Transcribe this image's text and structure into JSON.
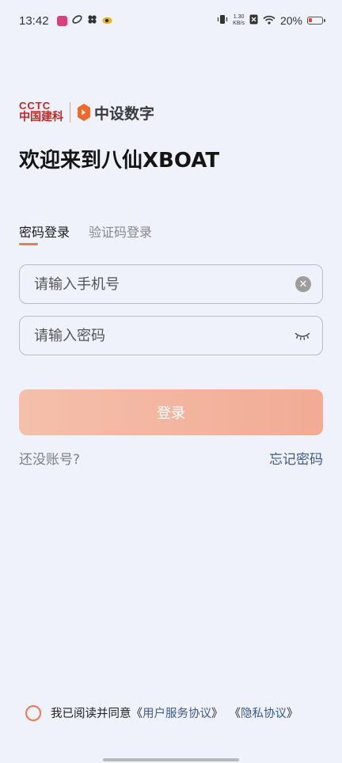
{
  "status_bar": {
    "time": "13:42",
    "speed_value": "1.30",
    "speed_unit": "KB/s",
    "battery": "20%"
  },
  "logo": {
    "brand1_top": "CCTC",
    "brand1_bottom": "中国建科",
    "brand2": "中设数字"
  },
  "welcome_title": "欢迎来到八仙XBOAT",
  "tabs": [
    {
      "label": "密码登录",
      "active": true
    },
    {
      "label": "验证码登录",
      "active": false
    }
  ],
  "form": {
    "phone_placeholder": "请输入手机号",
    "password_placeholder": "请输入密码",
    "phone_value": "",
    "password_value": ""
  },
  "login_button": "登录",
  "links": {
    "no_account": "还没账号?",
    "forgot_password": "忘记密码"
  },
  "agreement": {
    "prefix": "我已阅读并同意",
    "open1": "《",
    "service": "用户服务协议",
    "close1": "》",
    "open2": "《",
    "privacy": "隐私协议",
    "close2": "》",
    "checked": false
  },
  "colors": {
    "accent": "#f07a4f",
    "link": "#3d5b8f",
    "brand_red": "#c8261f",
    "background": "#eff2fb"
  }
}
